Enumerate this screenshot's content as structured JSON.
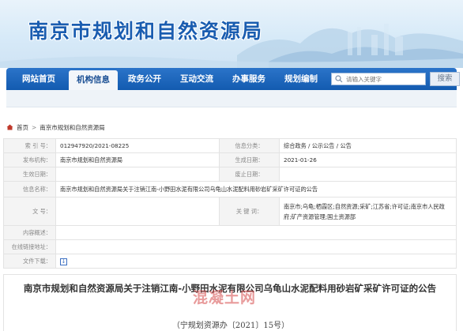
{
  "site": {
    "title": "南京市规划和自然资源局"
  },
  "nav": {
    "items": [
      {
        "label": "网站首页",
        "active": false
      },
      {
        "label": "机构信息",
        "active": true
      },
      {
        "label": "政务公开",
        "active": false
      },
      {
        "label": "互动交流",
        "active": false
      },
      {
        "label": "办事服务",
        "active": false
      },
      {
        "label": "规划编制",
        "active": false
      }
    ],
    "search_placeholder": "请输入关键字",
    "search_button": "搜索"
  },
  "breadcrumb": {
    "home": "首页",
    "separator": ">",
    "current": "南京市规划和自然资源局"
  },
  "info": {
    "index_label": "索 引 号：",
    "index_value": "012947920/2021-08225",
    "category_label": "信息分类：",
    "category_value": "综合政务 / 公示公告 / 公告",
    "publisher_label": "发布机构：",
    "publisher_value": "南京市规划和自然资源局",
    "created_label": "生成日期：",
    "created_value": "2021-01-26",
    "effective_label": "生效日期：",
    "effective_value": "",
    "expire_label": "废止日期：",
    "expire_value": "",
    "name_label": "信息名称：",
    "name_value": "南京市规划和自然资源局关于注销江南-小野田水泥有限公司乌龟山水泥配料用砂岩矿采矿许可证的公告",
    "docno_label": "文    号：",
    "docno_value": "",
    "keywords_label": "关 键 词：",
    "keywords_value": "南京市;乌龟;栖霞区;自然资源;采矿;江苏省;许可证;南京市人民政府;矿产资源管理;国土资源部",
    "overview_label": "内容概述：",
    "overview_value": "",
    "online_label": "在线链接地址：",
    "online_value": "",
    "download_label": "文件下载：",
    "download_icon": "↓"
  },
  "article": {
    "title": "南京市规划和自然资源局关于注销江南-小野田水泥有限公司乌龟山水泥配料用砂岩矿采矿许可证的公告",
    "doc_number": "（宁规划资源办〔2021〕15号）"
  },
  "watermark": "混凝土网",
  "colors": {
    "nav": "#135bb0",
    "title": "#1a5db0"
  }
}
